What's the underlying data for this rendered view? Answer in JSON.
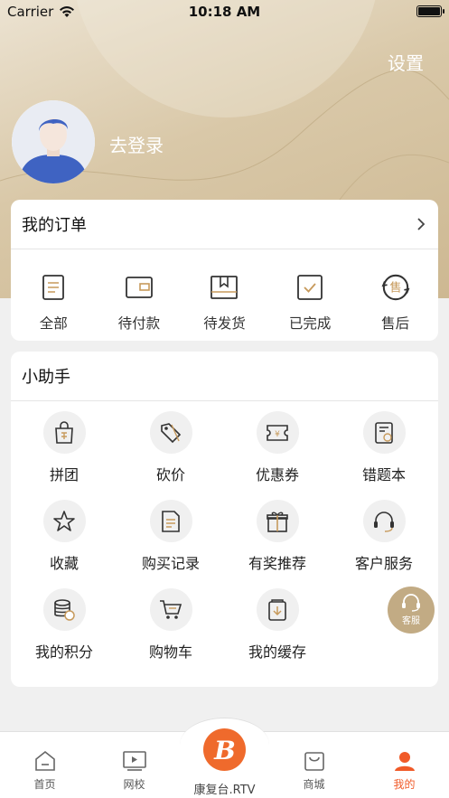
{
  "status_bar": {
    "carrier": "Carrier",
    "time": "10:18 AM"
  },
  "header": {
    "settings_label": "设置",
    "login_label": "去登录"
  },
  "orders": {
    "title": "我的订单",
    "items": [
      {
        "label": "全部",
        "icon": "document-icon"
      },
      {
        "label": "待付款",
        "icon": "wallet-icon"
      },
      {
        "label": "待发货",
        "icon": "package-icon"
      },
      {
        "label": "已完成",
        "icon": "check-box-icon"
      },
      {
        "label": "售后",
        "icon": "after-sale-icon"
      }
    ]
  },
  "helper": {
    "title": "小助手",
    "items": [
      {
        "label": "拼团",
        "icon": "group-buy-bag-icon"
      },
      {
        "label": "砍价",
        "icon": "bargain-tag-icon"
      },
      {
        "label": "优惠券",
        "icon": "coupon-icon"
      },
      {
        "label": "错题本",
        "icon": "mistake-book-icon"
      },
      {
        "label": "收藏",
        "icon": "star-icon"
      },
      {
        "label": "购买记录",
        "icon": "purchase-record-icon"
      },
      {
        "label": "有奖推荐",
        "icon": "gift-icon"
      },
      {
        "label": "客户服务",
        "icon": "headset-icon"
      },
      {
        "label": "我的积分",
        "icon": "points-coins-icon"
      },
      {
        "label": "购物车",
        "icon": "cart-icon"
      },
      {
        "label": "我的缓存",
        "icon": "download-cache-icon"
      }
    ]
  },
  "floating": {
    "kefu_label": "客服"
  },
  "tabbar": {
    "home": "首页",
    "school": "网校",
    "brand": "康复台.RTV",
    "mall": "商城",
    "mine": "我的"
  },
  "colors": {
    "accent": "#f05a28",
    "hero": "#d9c8a8",
    "kefu": "#c2ab84"
  }
}
